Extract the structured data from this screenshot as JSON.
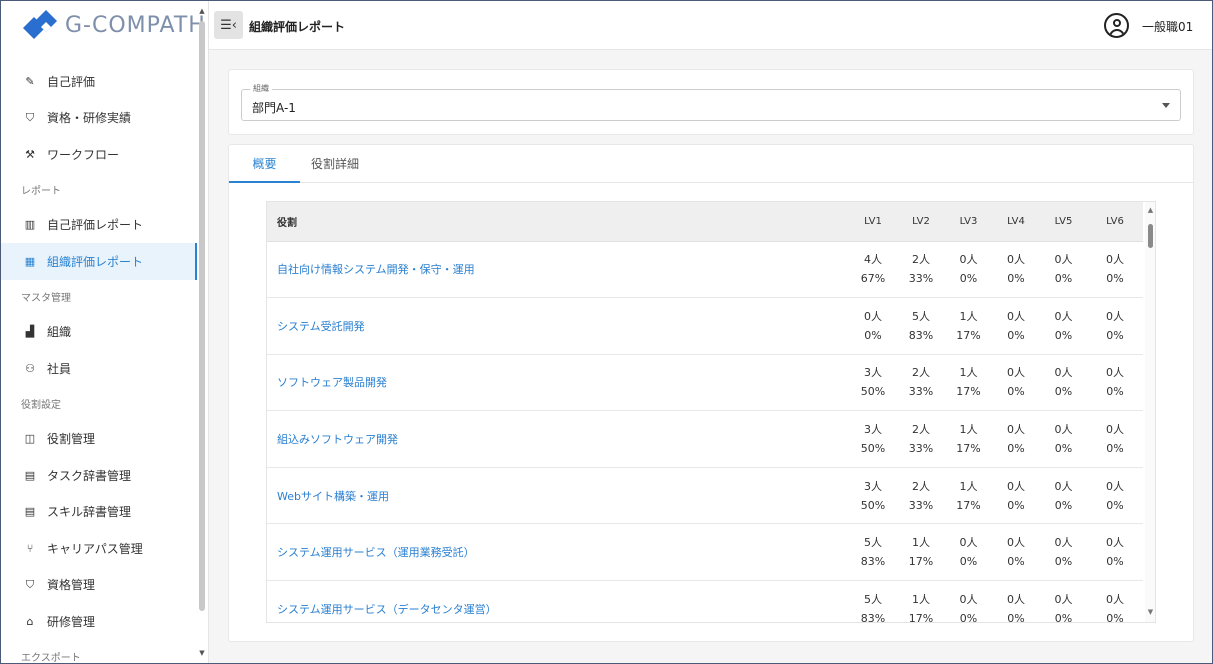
{
  "app": {
    "brand": "G-COMPATH",
    "brand_color": "#2a6fd0"
  },
  "header": {
    "page_title": "組織評価レポート",
    "user_name": "一般職01"
  },
  "sidebar": {
    "items": [
      {
        "type": "item",
        "icon": "pencil-icon",
        "glyph": "✎",
        "label": "自己評価"
      },
      {
        "type": "item",
        "icon": "shield-check-icon",
        "glyph": "⛉",
        "label": "資格・研修実績"
      },
      {
        "type": "item",
        "icon": "gavel-icon",
        "glyph": "⚒",
        "label": "ワークフロー"
      },
      {
        "type": "section",
        "label": "レポート"
      },
      {
        "type": "item",
        "icon": "bar-chart-icon",
        "glyph": "▥",
        "label": "自己評価レポート"
      },
      {
        "type": "item",
        "icon": "building-chart-icon",
        "glyph": "▦",
        "label": "組織評価レポート",
        "active": true
      },
      {
        "type": "section",
        "label": "マスタ管理"
      },
      {
        "type": "item",
        "icon": "organization-icon",
        "glyph": "▟",
        "label": "組織"
      },
      {
        "type": "item",
        "icon": "people-icon",
        "glyph": "⚇",
        "label": "社員"
      },
      {
        "type": "section",
        "label": "役割設定"
      },
      {
        "type": "item",
        "icon": "badge-icon",
        "glyph": "◫",
        "label": "役割管理"
      },
      {
        "type": "item",
        "icon": "task-dictionary-icon",
        "glyph": "▤",
        "label": "タスク辞書管理"
      },
      {
        "type": "item",
        "icon": "skill-dictionary-icon",
        "glyph": "▤",
        "label": "スキル辞書管理"
      },
      {
        "type": "item",
        "icon": "branch-icon",
        "glyph": "⑂",
        "label": "キャリアパス管理"
      },
      {
        "type": "item",
        "icon": "shield-icon",
        "glyph": "⛉",
        "label": "資格管理"
      },
      {
        "type": "item",
        "icon": "graduation-cap-icon",
        "glyph": "⌂",
        "label": "研修管理"
      },
      {
        "type": "section",
        "label": "エクスポート"
      }
    ]
  },
  "org_filter": {
    "legend": "組織",
    "value": "部門A-1"
  },
  "tabs": [
    {
      "label": "概要",
      "active": true
    },
    {
      "label": "役割詳細",
      "active": false
    }
  ],
  "table": {
    "role_header": "役割",
    "levels": [
      "LV1",
      "LV2",
      "LV3",
      "LV4",
      "LV5",
      "LV6"
    ],
    "rows": [
      {
        "role": "自社向け情報システム開発・保守・運用",
        "cells": [
          [
            "4人",
            "67%"
          ],
          [
            "2人",
            "33%"
          ],
          [
            "0人",
            "0%"
          ],
          [
            "0人",
            "0%"
          ],
          [
            "0人",
            "0%"
          ],
          [
            "0人",
            "0%"
          ]
        ]
      },
      {
        "role": "システム受託開発",
        "cells": [
          [
            "0人",
            "0%"
          ],
          [
            "5人",
            "83%"
          ],
          [
            "1人",
            "17%"
          ],
          [
            "0人",
            "0%"
          ],
          [
            "0人",
            "0%"
          ],
          [
            "0人",
            "0%"
          ]
        ]
      },
      {
        "role": "ソフトウェア製品開発",
        "cells": [
          [
            "3人",
            "50%"
          ],
          [
            "2人",
            "33%"
          ],
          [
            "1人",
            "17%"
          ],
          [
            "0人",
            "0%"
          ],
          [
            "0人",
            "0%"
          ],
          [
            "0人",
            "0%"
          ]
        ]
      },
      {
        "role": "組込みソフトウェア開発",
        "cells": [
          [
            "3人",
            "50%"
          ],
          [
            "2人",
            "33%"
          ],
          [
            "1人",
            "17%"
          ],
          [
            "0人",
            "0%"
          ],
          [
            "0人",
            "0%"
          ],
          [
            "0人",
            "0%"
          ]
        ]
      },
      {
        "role": "Webサイト構築・運用",
        "cells": [
          [
            "3人",
            "50%"
          ],
          [
            "2人",
            "33%"
          ],
          [
            "1人",
            "17%"
          ],
          [
            "0人",
            "0%"
          ],
          [
            "0人",
            "0%"
          ],
          [
            "0人",
            "0%"
          ]
        ]
      },
      {
        "role": "システム運用サービス（運用業務受託）",
        "cells": [
          [
            "5人",
            "83%"
          ],
          [
            "1人",
            "17%"
          ],
          [
            "0人",
            "0%"
          ],
          [
            "0人",
            "0%"
          ],
          [
            "0人",
            "0%"
          ],
          [
            "0人",
            "0%"
          ]
        ]
      },
      {
        "role": "システム運用サービス（データセンタ運営）",
        "cells": [
          [
            "5人",
            "83%"
          ],
          [
            "1人",
            "17%"
          ],
          [
            "0人",
            "0%"
          ],
          [
            "0人",
            "0%"
          ],
          [
            "0人",
            "0%"
          ],
          [
            "0人",
            "0%"
          ]
        ]
      }
    ]
  }
}
